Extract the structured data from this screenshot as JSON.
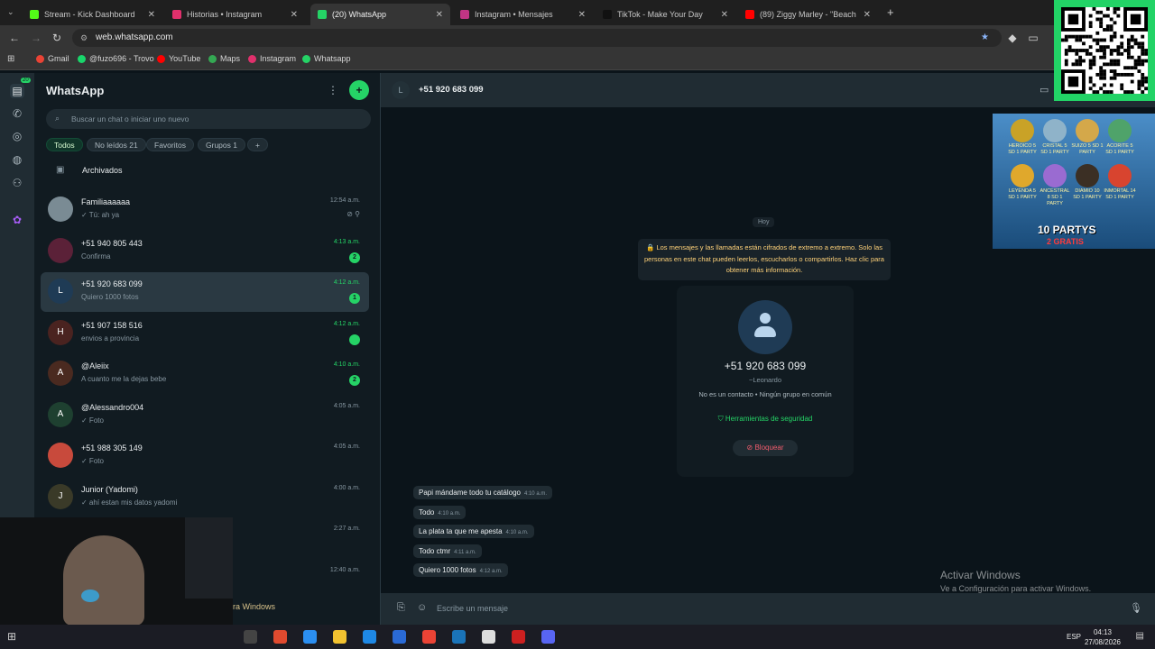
{
  "browser": {
    "tabs": [
      {
        "title": "Stream - Kick Dashboard",
        "color": "#53fc18"
      },
      {
        "title": "Historias • Instagram",
        "color": "#e1306c"
      },
      {
        "title": "(20) WhatsApp",
        "color": "#25d366"
      },
      {
        "title": "Instagram • Mensajes",
        "color": "#c13584"
      },
      {
        "title": "TikTok - Make Your Day",
        "color": "#111111"
      },
      {
        "title": "(89) Ziggy Marley - \"Beach",
        "color": "#ff0000"
      }
    ],
    "new_tab": "+",
    "url": "web.whatsapp.com",
    "bookmarks": [
      {
        "label": "Gmail",
        "color": "#ea4335"
      },
      {
        "label": "@fuzo696 - Trovo",
        "color": "#19d66b"
      },
      {
        "label": "YouTube",
        "color": "#ff0000"
      },
      {
        "label": "Maps",
        "color": "#34a853"
      },
      {
        "label": "Instagram",
        "color": "#e1306c"
      },
      {
        "label": "Whatsapp",
        "color": "#25d366"
      }
    ]
  },
  "rail": {
    "badge": "20"
  },
  "sidebar": {
    "title": "WhatsApp",
    "search_placeholder": "Buscar un chat o iniciar uno nuevo",
    "filters": [
      "Todos",
      "No leídos 21",
      "Favoritos",
      "Grupos 1",
      "+"
    ],
    "archived": "Archivados",
    "chats": [
      {
        "name": "Familiaaaaaa",
        "preview": "✓ Tú: ah ya",
        "time": "12:54 a.m.",
        "initial": "",
        "color": "#7a8b94",
        "unread": "",
        "time_unread": false
      },
      {
        "name": "+51 940 805 443",
        "preview": "Confirma",
        "time": "4:13 a.m.",
        "initial": "",
        "color": "#5b2138",
        "unread": "2",
        "time_unread": true
      },
      {
        "name": "+51 920 683 099",
        "preview": "Quiero 1000 fotos",
        "time": "4:12 a.m.",
        "initial": "L",
        "color": "#1f3b55",
        "unread": "1",
        "time_unread": true
      },
      {
        "name": "+51 907 158 516",
        "preview": "envios a provincia",
        "time": "4:12 a.m.",
        "initial": "H",
        "color": "#4a2320",
        "unread": "",
        "time_unread": true
      },
      {
        "name": "@Aleiix",
        "preview": "A cuanto me la dejas bebe",
        "time": "4:10 a.m.",
        "initial": "A",
        "color": "#4a2a20",
        "unread": "2",
        "time_unread": true
      },
      {
        "name": "@Alessandro004",
        "preview": "✓ Foto",
        "time": "4:05 a.m.",
        "initial": "A",
        "color": "#1e4030",
        "unread": "",
        "time_unread": false
      },
      {
        "name": "+51 988 305 149",
        "preview": "✓ Foto",
        "time": "4:05 a.m.",
        "initial": "",
        "color": "#c84a3c",
        "unread": "",
        "time_unread": false
      },
      {
        "name": "Junior (Yadomi)",
        "preview": "✓ ahí estan mis datos yadomi",
        "time": "4:00 a.m.",
        "initial": "J",
        "color": "#3a3a28",
        "unread": "",
        "time_unread": false
      },
      {
        "name": "",
        "preview": "",
        "time": "2:27 a.m.",
        "initial": "",
        "color": "#111b21",
        "unread": "",
        "time_unread": false
      },
      {
        "name": "",
        "preview": "",
        "time": "12:40 a.m.",
        "initial": "",
        "color": "#111b21",
        "unread": "",
        "time_unread": false
      }
    ]
  },
  "chat": {
    "header_initial": "L",
    "header_name": "+51 920 683 099",
    "day": "Hoy",
    "encryption_notice": "🔒 Los mensajes y las llamadas están cifrados de extremo a extremo. Solo las personas en este chat pueden leerlos, escucharlos o compartirlos. Haz clic para obtener más información.",
    "contact": {
      "number": "+51 920 683 099",
      "alias": "~Leonardo",
      "info": "No es un contacto • Ningún grupo en común",
      "security": "Herramientas de seguridad",
      "block": "Bloquear"
    },
    "messages": [
      {
        "text": "Papi mándame todo tu catálogo",
        "time": "4:10 a.m."
      },
      {
        "text": "Todo",
        "time": "4:10 a.m."
      },
      {
        "text": "La plata ta que me apesta",
        "time": "4:10 a.m."
      },
      {
        "text": "Todo ctmr",
        "time": "4:11 a.m."
      },
      {
        "text": "Quiero 1000 fotos",
        "time": "4:12 a.m."
      }
    ],
    "composer_placeholder": "Escribe un mensaje"
  },
  "windows_activation": {
    "title": "Activar Windows",
    "subtitle": "Ve a Configuración para activar Windows."
  },
  "webcam_overlay_text": "ra Windows",
  "promo": {
    "headline": "10 PARTYS",
    "sub": "2 GRATIS",
    "ranks": [
      "HEROICO 5 SD 1 PARTY",
      "CRISTAL 5 SD 1 PARTY",
      "SUIZO 5 SD 1 PARTY",
      "ACORITE 5 SD 1 PARTY",
      "LEYENDA 5 SD 1 PARTY",
      "ANCESTRAL 8 SD 1 PARTY",
      "DIAMIO 10 SD 1 PARTY",
      "INMORTAL 14 SD 1 PARTY"
    ]
  },
  "taskbar": {
    "lang": "ESP",
    "time": "04:13",
    "date": "27/08/2026"
  }
}
